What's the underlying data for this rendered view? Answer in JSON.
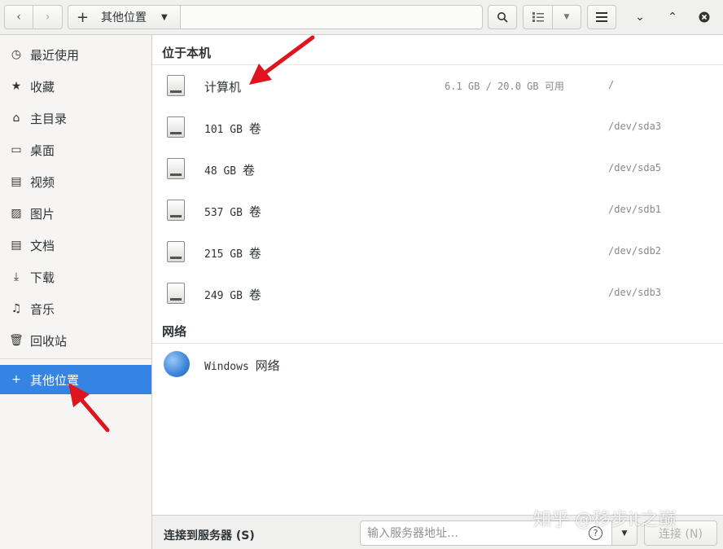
{
  "header": {
    "location_label": "其他位置"
  },
  "sidebar": {
    "items": [
      {
        "icon": "recent-icon",
        "glyph": "◷",
        "label": "最近使用"
      },
      {
        "icon": "star-icon",
        "glyph": "★",
        "label": "收藏"
      },
      {
        "icon": "home-icon",
        "glyph": "⌂",
        "label": "主目录"
      },
      {
        "icon": "desktop-icon",
        "glyph": "▭",
        "label": "桌面"
      },
      {
        "icon": "video-icon",
        "glyph": "▤",
        "label": "视频"
      },
      {
        "icon": "picture-icon",
        "glyph": "▨",
        "label": "图片"
      },
      {
        "icon": "document-icon",
        "glyph": "▤",
        "label": "文档"
      },
      {
        "icon": "download-icon",
        "glyph": "⤓",
        "label": "下载"
      },
      {
        "icon": "music-icon",
        "glyph": "♫",
        "label": "音乐"
      },
      {
        "icon": "trash-icon",
        "glyph": "🗑",
        "label": "回收站"
      }
    ],
    "other_locations": {
      "glyph": "+",
      "label": "其他位置"
    }
  },
  "main": {
    "local_section_title": "位于本机",
    "local_items": [
      {
        "name": "计算机",
        "info": "6.1 GB / 20.0 GB 可用",
        "path": "/"
      },
      {
        "name_num": "101 GB",
        "name_suffix": "卷",
        "path": "/dev/sda3"
      },
      {
        "name_num": "48 GB",
        "name_suffix": "卷",
        "path": "/dev/sda5"
      },
      {
        "name_num": "537 GB",
        "name_suffix": "卷",
        "path": "/dev/sdb1"
      },
      {
        "name_num": "215 GB",
        "name_suffix": "卷",
        "path": "/dev/sdb2"
      },
      {
        "name_num": "249 GB",
        "name_suffix": "卷",
        "path": "/dev/sdb3"
      }
    ],
    "network_section_title": "网络",
    "network_items": [
      {
        "name_prefix": "Windows",
        "name_suffix": "网络"
      }
    ]
  },
  "bottom": {
    "connect_label": "连接到服务器 (S)",
    "server_placeholder": "输入服务器地址…",
    "connect_button": "连接 (N)"
  },
  "watermark": "知乎 @移步it之巅",
  "colors": {
    "accent": "#3584e4",
    "arrow": "#e0141e"
  }
}
